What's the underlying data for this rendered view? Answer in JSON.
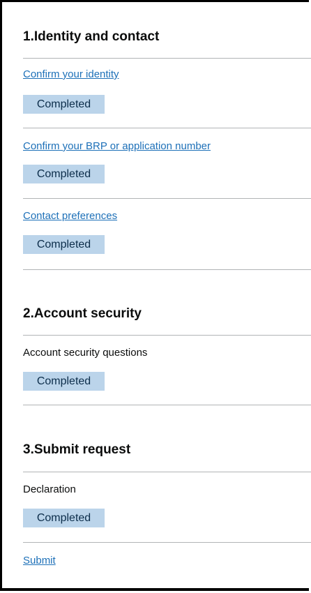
{
  "sections": [
    {
      "heading": "1.Identity and contact",
      "tasks": [
        {
          "label": "Confirm your identity",
          "status": "Completed"
        },
        {
          "label": "Confirm your BRP or application number",
          "status": "Completed"
        },
        {
          "label": "Contact preferences",
          "status": "Completed"
        }
      ]
    },
    {
      "heading": "2.Account security",
      "tasks": [
        {
          "label": "Account security questions",
          "status": "Completed"
        }
      ]
    },
    {
      "heading": "3.Submit request",
      "tasks": [
        {
          "label": "Declaration",
          "status": "Completed"
        },
        {
          "label": "Submit"
        }
      ]
    }
  ],
  "colors": {
    "link": "#1d70b8",
    "tag_background": "#bbd4ea",
    "tag_text": "#0c2d4a",
    "divider": "#b1b4b6"
  }
}
